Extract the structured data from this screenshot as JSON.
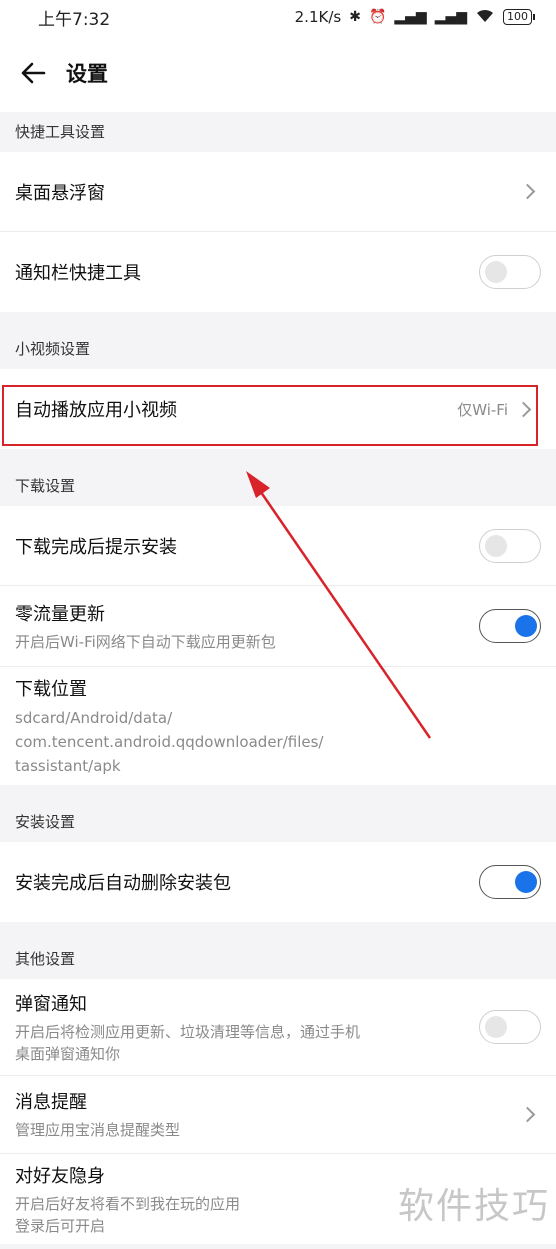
{
  "status_bar": {
    "time": "上午7:32",
    "speed": "2.1K/s",
    "battery": "100"
  },
  "app_bar": {
    "title": "设置"
  },
  "sections": {
    "quick_tools": {
      "header": "快捷工具设置",
      "floating_window": "桌面悬浮窗",
      "notification_tools": "通知栏快捷工具"
    },
    "short_video": {
      "header": "小视频设置",
      "autoplay": "自动播放应用小视频",
      "autoplay_value": "仅Wi-Fi"
    },
    "download": {
      "header": "下载设置",
      "prompt_install": "下载完成后提示安装",
      "zero_traffic": "零流量更新",
      "zero_traffic_sub": "开启后Wi-Fi网络下自动下载应用更新包",
      "location": "下载位置",
      "location_sub1": "sdcard/Android/data/",
      "location_sub2": "com.tencent.android.qqdownloader/files/",
      "location_sub3": "tassistant/apk"
    },
    "install": {
      "header": "安装设置",
      "auto_delete": "安装完成后自动删除安装包"
    },
    "other": {
      "header": "其他设置",
      "popup": "弹窗通知",
      "popup_sub1": "开启后将检测应用更新、垃圾清理等信息，通过手机",
      "popup_sub2": "桌面弹窗通知你",
      "message": "消息提醒",
      "message_sub": "管理应用宝消息提醒类型",
      "invisible": "对好友隐身",
      "invisible_sub1": "开启后好友将看不到我在玩的应用",
      "invisible_sub2": "登录后可开启"
    }
  },
  "toggles": {
    "notification_tools": false,
    "prompt_install": false,
    "zero_traffic": true,
    "auto_delete": true,
    "popup": false
  },
  "colors": {
    "accent": "#1a73e8",
    "highlight": "#d8232a"
  },
  "watermark": "软件技巧"
}
